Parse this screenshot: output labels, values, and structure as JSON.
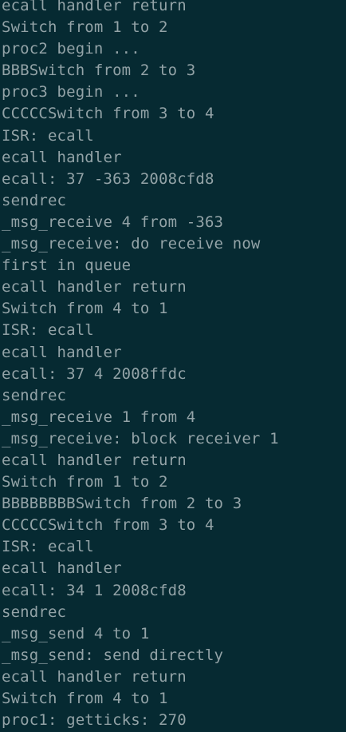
{
  "terminal": {
    "background": "#062a32",
    "foreground": "#93a3a7",
    "lines": [
      "ecall handler return",
      "Switch from 1 to 2",
      "proc2 begin ...",
      "BBBSwitch from 2 to 3",
      "proc3 begin ...",
      "CCCCCSwitch from 3 to 4",
      "ISR: ecall",
      "ecall handler",
      "ecall: 37 -363 2008cfd8",
      "sendrec",
      "_msg_receive 4 from -363",
      "_msg_receive: do receive now",
      "first in queue",
      "ecall handler return",
      "Switch from 4 to 1",
      "ISR: ecall",
      "ecall handler",
      "ecall: 37 4 2008ffdc",
      "sendrec",
      "_msg_receive 1 from 4",
      "_msg_receive: block receiver 1",
      "ecall handler return",
      "Switch from 1 to 2",
      "BBBBBBBBSwitch from 2 to 3",
      "CCCCCSwitch from 3 to 4",
      "ISR: ecall",
      "ecall handler",
      "ecall: 34 1 2008cfd8",
      "sendrec",
      "_msg_send 4 to 1",
      "_msg_send: send directly",
      "ecall handler return",
      "Switch from 4 to 1",
      "proc1: getticks: 270"
    ]
  }
}
